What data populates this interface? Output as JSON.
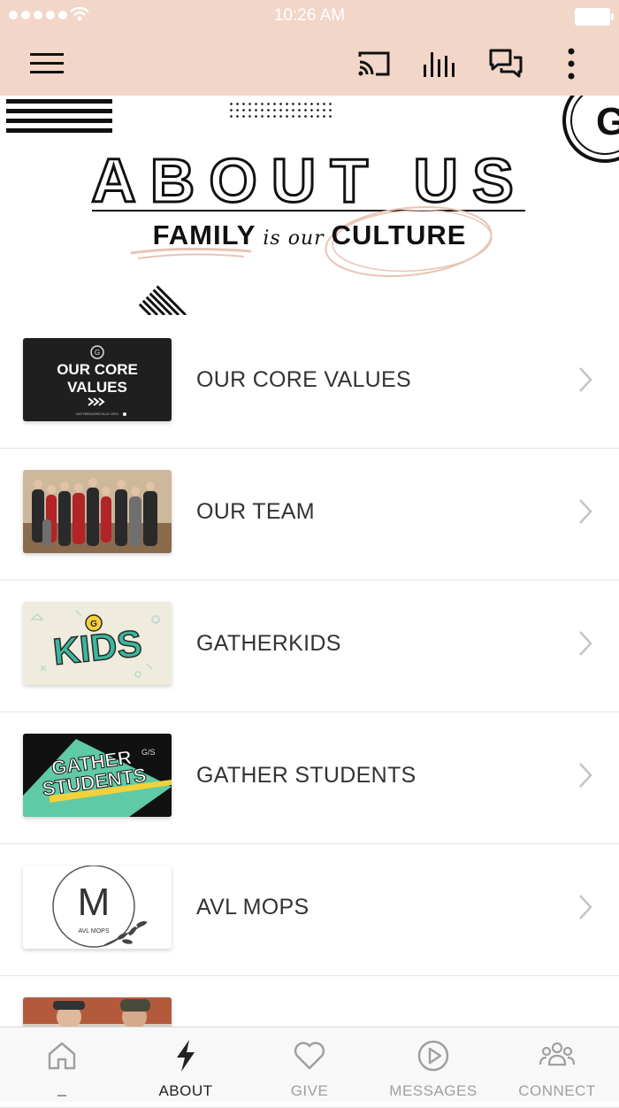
{
  "status_bar": {
    "time": "10:26 AM"
  },
  "hero": {
    "title": "ABOUT US",
    "subtitle_left": "FAMILY",
    "subtitle_script": "is our",
    "subtitle_right": "CULTURE",
    "logo_letter": "G"
  },
  "items": [
    {
      "label": "OUR CORE VALUES",
      "thumb": {
        "line1": "OUR CORE",
        "line2": "VALUES",
        "footer": "GATHERASHEVILLE.ORG",
        "badge": "G"
      }
    },
    {
      "label": "OUR TEAM"
    },
    {
      "label": "GATHERKIDS",
      "thumb": {
        "word": "KIDS",
        "badge": "G"
      }
    },
    {
      "label": "GATHER STUDENTS",
      "thumb": {
        "line1": "GATHER",
        "line2": "STUDENTS",
        "badge": "G/S"
      }
    },
    {
      "label": "AVL MOPS",
      "thumb": {
        "letter": "M",
        "caption": "AVL MOPS"
      }
    }
  ],
  "tabs": [
    {
      "label": "",
      "icon": "home-icon",
      "active": false
    },
    {
      "label": "ABOUT",
      "icon": "bolt-icon",
      "active": true
    },
    {
      "label": "GIVE",
      "icon": "heart-icon",
      "active": false
    },
    {
      "label": "MESSAGES",
      "icon": "play-circle-icon",
      "active": false
    },
    {
      "label": "CONNECT",
      "icon": "people-icon",
      "active": false
    }
  ],
  "colors": {
    "header_bg": "#f2d6c8",
    "accent_peach": "#e8c4b4",
    "text_dark": "#333333",
    "tab_inactive": "#a0a0a0"
  }
}
